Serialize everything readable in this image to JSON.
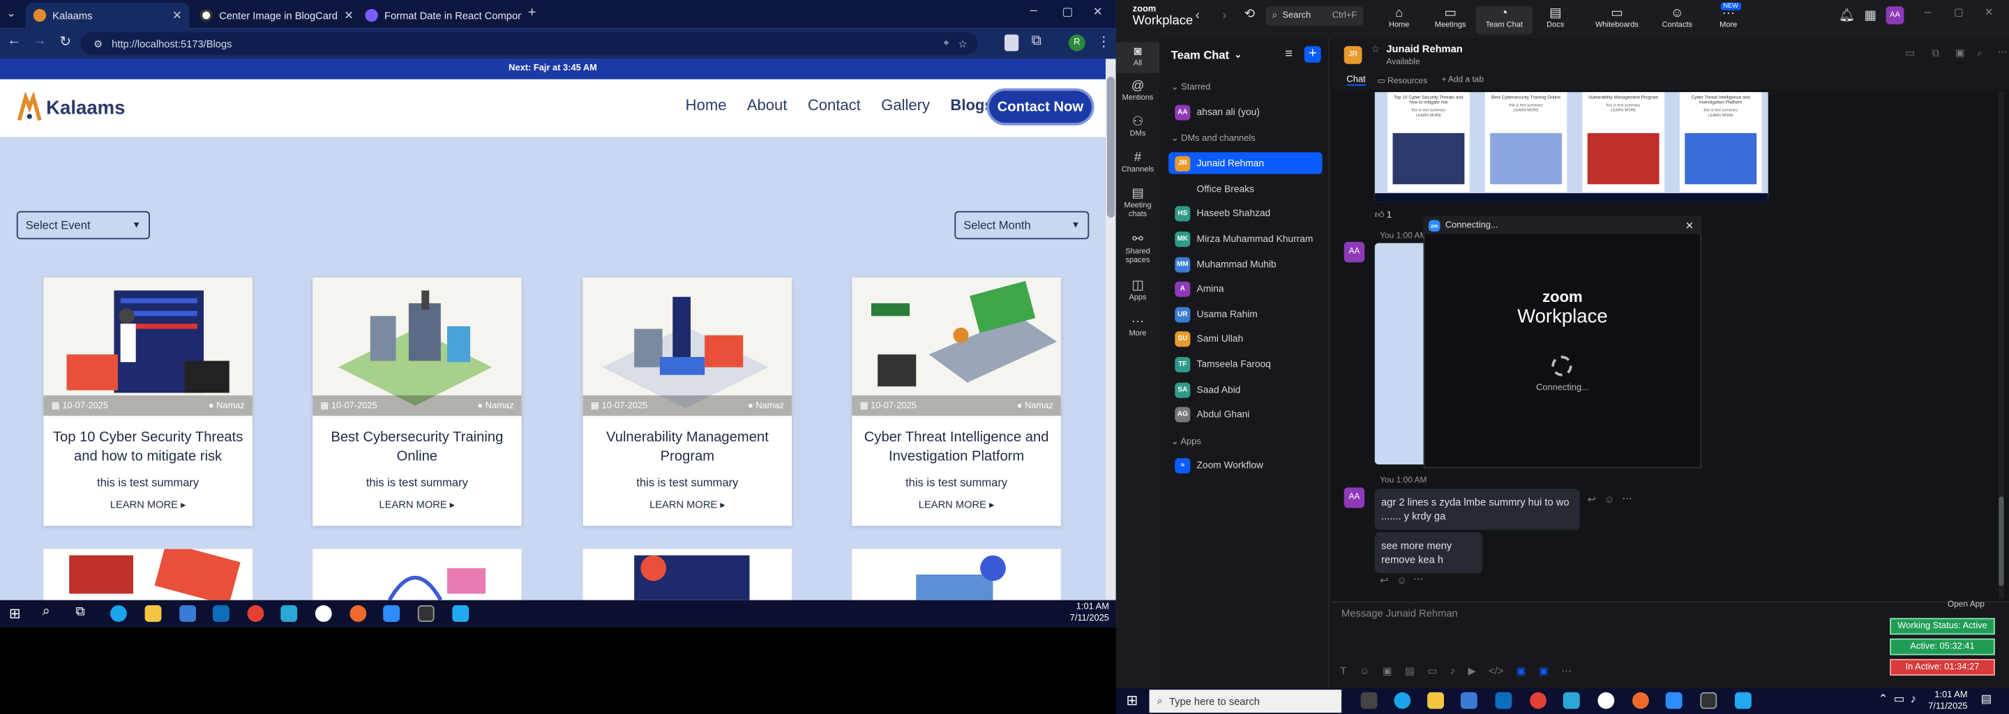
{
  "browser": {
    "tabs": [
      {
        "label": "Kalaams",
        "active": true
      },
      {
        "label": "Center Image in BlogCard",
        "active": false
      },
      {
        "label": "Format Date in React Compon",
        "active": false
      }
    ],
    "url": "http://localhost:5173/Blogs"
  },
  "site": {
    "announcement": "Next: Fajr at 3:45 AM",
    "logo_text": "Kalaams",
    "nav": [
      "Home",
      "About",
      "Contact",
      "Gallery",
      "Blogs"
    ],
    "contact_button": "Contact Now",
    "filter_event": "Select Event",
    "filter_month": "Select Month",
    "cards": [
      {
        "date": "10-07-2025",
        "category": "Namaz",
        "title": "Top 10 Cyber Security Threats and how to mitigate risk",
        "summary": "this is test summary",
        "more": "LEARN MORE"
      },
      {
        "date": "10-07-2025",
        "category": "Namaz",
        "title": "Best Cybersecurity Training Online",
        "summary": "this is test summary",
        "more": "LEARN MORE"
      },
      {
        "date": "10-07-2025",
        "category": "Namaz",
        "title": "Vulnerability Management Program",
        "summary": "this is test summary",
        "more": "LEARN MORE"
      },
      {
        "date": "10-07-2025",
        "category": "Namaz",
        "title": "Cyber Threat Intelligence and Investigation Platform",
        "summary": "this is test summary",
        "more": "LEARN MORE"
      }
    ]
  },
  "taskbar_left": {
    "time": "1:01 AM",
    "date": "7/11/2025"
  },
  "zoom": {
    "brand_top": "zoom",
    "brand_bottom": "Workplace",
    "search": "Search",
    "search_shortcut": "Ctrl+F",
    "top_nav": [
      "Home",
      "Meetings",
      "Team Chat",
      "Docs",
      "Whiteboards",
      "Contacts",
      "More"
    ],
    "more_badge": "NEW",
    "user_initials": "AA",
    "rail": [
      "All",
      "Mentions",
      "DMs",
      "Channels",
      "Meeting chats",
      "Shared spaces",
      "Apps",
      "More"
    ],
    "sidebar_title": "Team Chat",
    "sections": {
      "starred": "Starred",
      "dms": "DMs and channels",
      "apps": "Apps"
    },
    "starred_items": [
      {
        "initials": "AA",
        "name": "ahsan ali (you)"
      }
    ],
    "dm_items": [
      {
        "initials": "JR",
        "name": "Junaid Rehman",
        "selected": true
      },
      {
        "initials": "",
        "name": "Office Breaks",
        "selected": false
      },
      {
        "initials": "HS",
        "name": "Haseeb Shahzad",
        "selected": false
      },
      {
        "initials": "MK",
        "name": "Mirza Muhammad Khurram",
        "selected": false
      },
      {
        "initials": "MM",
        "name": "Muhammad Muhib",
        "selected": false
      },
      {
        "initials": "A",
        "name": "Amina",
        "selected": false
      },
      {
        "initials": "UR",
        "name": "Usama Rahim",
        "selected": false
      },
      {
        "initials": "SU",
        "name": "Sami Ullah",
        "selected": false
      },
      {
        "initials": "TF",
        "name": "Tamseela Farooq",
        "selected": false
      },
      {
        "initials": "SA",
        "name": "Saad Abid",
        "selected": false
      },
      {
        "initials": "AG",
        "name": "Abdul Ghani",
        "selected": false
      }
    ],
    "app_items": [
      {
        "name": "Zoom Workflow"
      }
    ],
    "chat": {
      "contact_initials": "JR",
      "contact_name": "Junaid Rehman",
      "contact_status": "Available",
      "tabs": [
        "Chat",
        "Resources",
        "Add a tab"
      ],
      "reaction": "1",
      "sender_label_1": "You",
      "time_1": "1:00 AM",
      "sender_label_2": "You",
      "time_2": "1:00 AM",
      "message_1": "agr 2 lines s zyda lmbe summry hui to wo ....... y krdy ga",
      "message_2": "see more meny remove kea h",
      "input_placeholder": "Message Junaid Rehman",
      "open_app": "Open App"
    },
    "thumb_titles": [
      "Top 10 Cyber Security Threats and how to mitigate risk",
      "Best Cybersecurity Training Online",
      "Vulnerability Management Program",
      "Cyber Threat Intelligence and Investigation Platform"
    ],
    "thumb_summary": "this is test summary",
    "thumb_more": "LEARN MORE",
    "connecting_title": "Connecting...",
    "connecting_logo_top": "zoom",
    "connecting_logo_bottom": "Workplace",
    "connecting_text": "Connecting...",
    "status": {
      "working": "Working Status: Active",
      "active": "Active: 05:32:41",
      "inactive": "In Active: 01:34:27"
    }
  },
  "taskbar_right": {
    "search_placeholder": "Type here to search",
    "time": "1:01 AM",
    "date": "7/11/2025"
  },
  "colors": {
    "accent_blue": "#1c3aa6",
    "zoom_blue": "#0b5cff",
    "page_bg": "#c9d8f0",
    "status_green": "#1f9d55",
    "status_red": "#d63a3a"
  }
}
